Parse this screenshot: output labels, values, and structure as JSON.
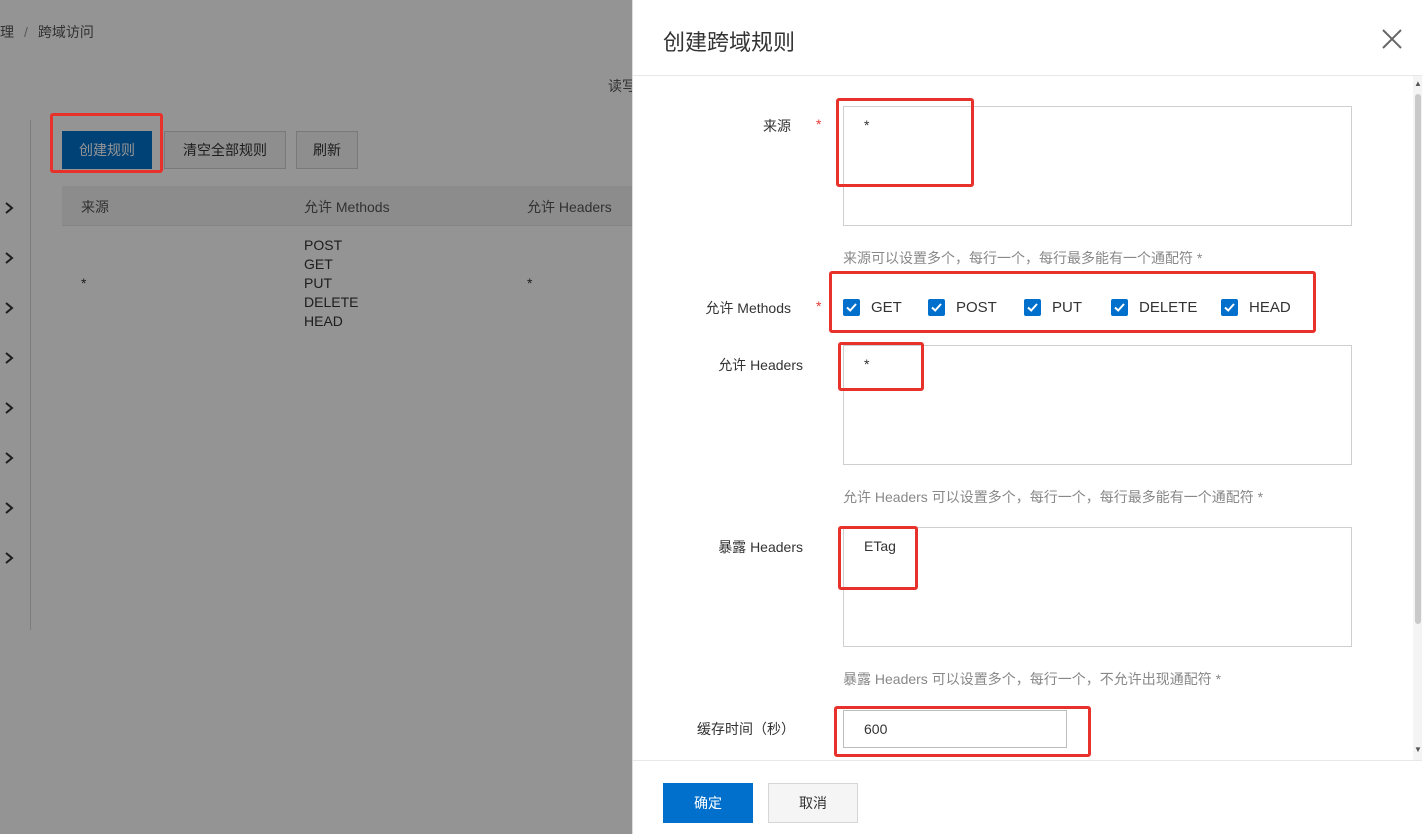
{
  "background": {
    "breadcrumb": [
      "管理",
      "跨域访问"
    ],
    "breadcrumb_sep": "/",
    "readwrite_text": "读写",
    "buttons": {
      "create_rule": "创建规则",
      "clear_all": "清空全部规则",
      "refresh": "刷新"
    },
    "table": {
      "headers": [
        "来源",
        "允许 Methods",
        "允许 Headers"
      ],
      "rows": [
        {
          "origin": "*",
          "methods": [
            "POST",
            "GET",
            "PUT",
            "DELETE",
            "HEAD"
          ],
          "headers": "*"
        }
      ]
    }
  },
  "dialog": {
    "title": "创建跨域规则",
    "origin": {
      "label": "来源",
      "required": "*",
      "value": "*",
      "hint": "来源可以设置多个，每行一个，每行最多能有一个通配符 *"
    },
    "methods": {
      "label": "允许 Methods",
      "required": "*",
      "options": [
        {
          "label": "GET",
          "checked": true
        },
        {
          "label": "POST",
          "checked": true
        },
        {
          "label": "PUT",
          "checked": true
        },
        {
          "label": "DELETE",
          "checked": true
        },
        {
          "label": "HEAD",
          "checked": true
        }
      ]
    },
    "allow_headers": {
      "label": "允许 Headers",
      "value": "*",
      "hint": "允许 Headers 可以设置多个，每行一个，每行最多能有一个通配符 *"
    },
    "expose_headers": {
      "label": "暴露 Headers",
      "value": "ETag",
      "hint": "暴露 Headers 可以设置多个，每行一个，不允许出现通配符 *"
    },
    "cache_time": {
      "label": "缓存时间（秒）",
      "value": "600"
    },
    "footer": {
      "ok": "确定",
      "cancel": "取消"
    }
  },
  "colors": {
    "primary": "#0070cc",
    "annotation_red": "#e8312a",
    "required_star": "#e53935"
  },
  "icons": [
    "chevron-right-icon",
    "close-icon",
    "checkbox-checked-icon"
  ]
}
